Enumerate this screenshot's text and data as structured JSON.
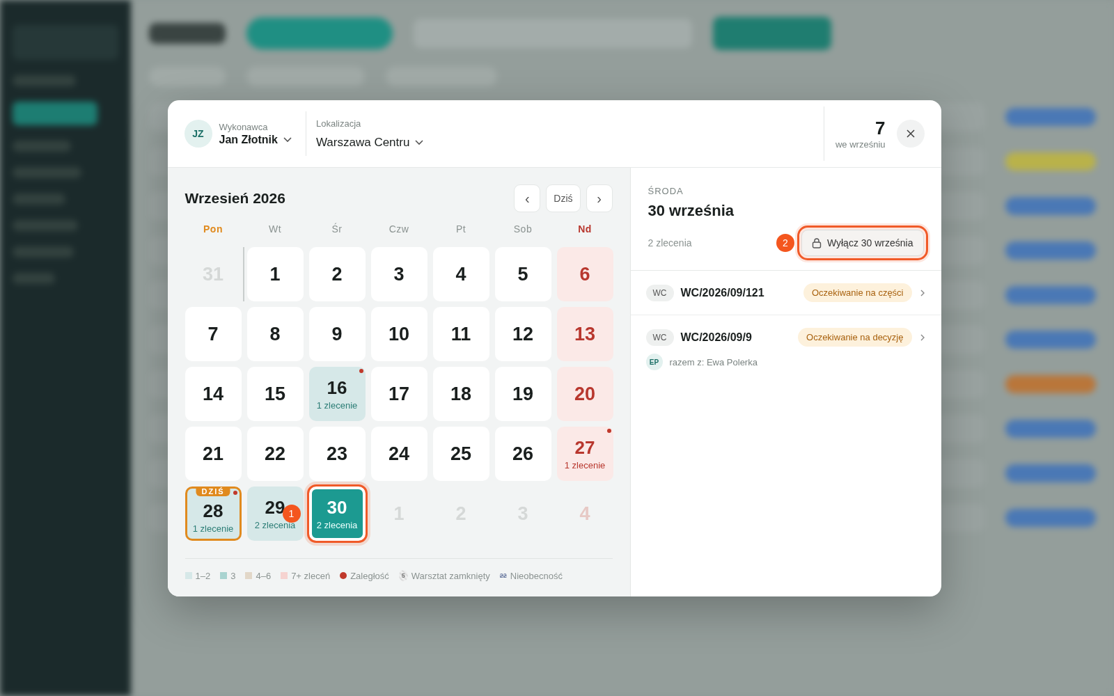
{
  "header": {
    "performer": {
      "initials": "JZ",
      "label": "Wykonawca",
      "name": "Jan Złotnik"
    },
    "location": {
      "label": "Lokalizacja",
      "value": "Warszawa Centru"
    },
    "count": {
      "value": "7",
      "caption": "we wrześniu"
    }
  },
  "calendar": {
    "title": "Wrzesień 2026",
    "nav": [
      {
        "kind": "prev",
        "label": "‹"
      },
      {
        "kind": "today",
        "label": "Dziś"
      },
      {
        "kind": "next",
        "label": "›"
      }
    ],
    "weekdays": [
      {
        "label": "Pon",
        "kind": "today"
      },
      {
        "label": "Wt",
        "kind": "normal"
      },
      {
        "label": "Śr",
        "kind": "normal"
      },
      {
        "label": "Czw",
        "kind": "normal"
      },
      {
        "label": "Pt",
        "kind": "normal"
      },
      {
        "label": "Sob",
        "kind": "normal"
      },
      {
        "label": "Nd",
        "kind": "sunday"
      }
    ],
    "days": [
      {
        "label": "31",
        "kind": "outside",
        "overdue": false,
        "today": false,
        "selected": false
      },
      {
        "label": "1",
        "kind": "weekday",
        "overdue": false,
        "today": false,
        "selected": false
      },
      {
        "label": "2",
        "kind": "weekday",
        "overdue": false,
        "today": false,
        "selected": false
      },
      {
        "label": "3",
        "kind": "weekday",
        "overdue": false,
        "today": false,
        "selected": false
      },
      {
        "label": "4",
        "kind": "weekday",
        "overdue": false,
        "today": false,
        "selected": false
      },
      {
        "label": "5",
        "kind": "weekday",
        "overdue": false,
        "today": false,
        "selected": false
      },
      {
        "label": "6",
        "kind": "sunday",
        "overdue": false,
        "today": false,
        "selected": false
      },
      {
        "label": "7",
        "kind": "weekday",
        "overdue": false,
        "today": false,
        "selected": false
      },
      {
        "label": "8",
        "kind": "weekday",
        "overdue": false,
        "today": false,
        "selected": false
      },
      {
        "label": "9",
        "kind": "weekday",
        "overdue": false,
        "today": false,
        "selected": false
      },
      {
        "label": "10",
        "kind": "weekday",
        "overdue": false,
        "today": false,
        "selected": false
      },
      {
        "label": "11",
        "kind": "weekday",
        "overdue": false,
        "today": false,
        "selected": false
      },
      {
        "label": "12",
        "kind": "weekday",
        "overdue": false,
        "today": false,
        "selected": false
      },
      {
        "label": "13",
        "kind": "sunday",
        "overdue": false,
        "today": false,
        "selected": false
      },
      {
        "label": "14",
        "kind": "weekday",
        "overdue": false,
        "today": false,
        "selected": false
      },
      {
        "label": "15",
        "kind": "weekday",
        "overdue": false,
        "today": false,
        "selected": false
      },
      {
        "label": "16",
        "kind": "weekday",
        "orders": "1 zlecenie",
        "overdue": true,
        "today": false,
        "selected": false
      },
      {
        "label": "17",
        "kind": "weekday",
        "overdue": false,
        "today": false,
        "selected": false
      },
      {
        "label": "18",
        "kind": "weekday",
        "overdue": false,
        "today": false,
        "selected": false
      },
      {
        "label": "19",
        "kind": "weekday",
        "overdue": false,
        "today": false,
        "selected": false
      },
      {
        "label": "20",
        "kind": "sunday",
        "overdue": false,
        "today": false,
        "selected": false
      },
      {
        "label": "21",
        "kind": "weekday",
        "overdue": false,
        "today": false,
        "selected": false
      },
      {
        "label": "22",
        "kind": "weekday",
        "overdue": false,
        "today": false,
        "selected": false
      },
      {
        "label": "23",
        "kind": "weekday",
        "overdue": false,
        "today": false,
        "selected": false
      },
      {
        "label": "24",
        "kind": "weekday",
        "overdue": false,
        "today": false,
        "selected": false
      },
      {
        "label": "25",
        "kind": "weekday",
        "overdue": false,
        "today": false,
        "selected": false
      },
      {
        "label": "26",
        "kind": "weekday",
        "overdue": false,
        "today": false,
        "selected": false
      },
      {
        "label": "27",
        "kind": "sunday",
        "orders": "1 zlecenie",
        "overdue": true,
        "today": false,
        "selected": false
      },
      {
        "label": "28",
        "kind": "weekday",
        "orders": "1 zlecenie",
        "overdue": true,
        "today": true,
        "today_label": "DZIŚ",
        "selected": false
      },
      {
        "label": "29",
        "kind": "weekday",
        "orders": "2 zlecenia",
        "overdue": false,
        "today": false,
        "selected": false,
        "marker": "1"
      },
      {
        "label": "30",
        "kind": "weekday",
        "orders": "2 zlecenia",
        "overdue": false,
        "today": false,
        "selected": true
      },
      {
        "label": "1",
        "kind": "outside",
        "overdue": false,
        "today": false,
        "selected": false
      },
      {
        "label": "2",
        "kind": "outside",
        "overdue": false,
        "today": false,
        "selected": false
      },
      {
        "label": "3",
        "kind": "outside",
        "overdue": false,
        "today": false,
        "selected": false
      },
      {
        "label": "4",
        "kind": "outside_sunday",
        "overdue": false,
        "today": false,
        "selected": false
      }
    ],
    "legend": [
      {
        "kind": "swatch",
        "color": "#d6e8e8",
        "label": "1–2"
      },
      {
        "kind": "swatch",
        "color": "#a9d3d0",
        "label": "3"
      },
      {
        "kind": "swatch",
        "color": "#e2d7c8",
        "label": "4–6"
      },
      {
        "kind": "swatch",
        "color": "#f6d3d0",
        "label": "7+ zleceń"
      },
      {
        "kind": "dot",
        "color": "#c0392b",
        "label": "Zaległość"
      },
      {
        "kind": "closed",
        "sample": "5",
        "label": "Warsztat zamknięty"
      },
      {
        "kind": "absence",
        "sample": "22",
        "label": "Nieobecność"
      }
    ]
  },
  "day_panel": {
    "weekday": "ŚRODA",
    "date": "30 września",
    "count": "2 zlecenia",
    "marker": "2",
    "button": {
      "label": "Wyłącz 30 września",
      "highlighted": true
    },
    "orders": [
      {
        "prefix": "WC",
        "number": "WC/2026/09/121",
        "status": "Oczekiwanie na części"
      },
      {
        "prefix": "WC",
        "number": "WC/2026/09/9",
        "status": "Oczekiwanie na decyzję",
        "with": {
          "initials": "EP",
          "text": "razem z: Ewa Polerka"
        }
      }
    ]
  }
}
